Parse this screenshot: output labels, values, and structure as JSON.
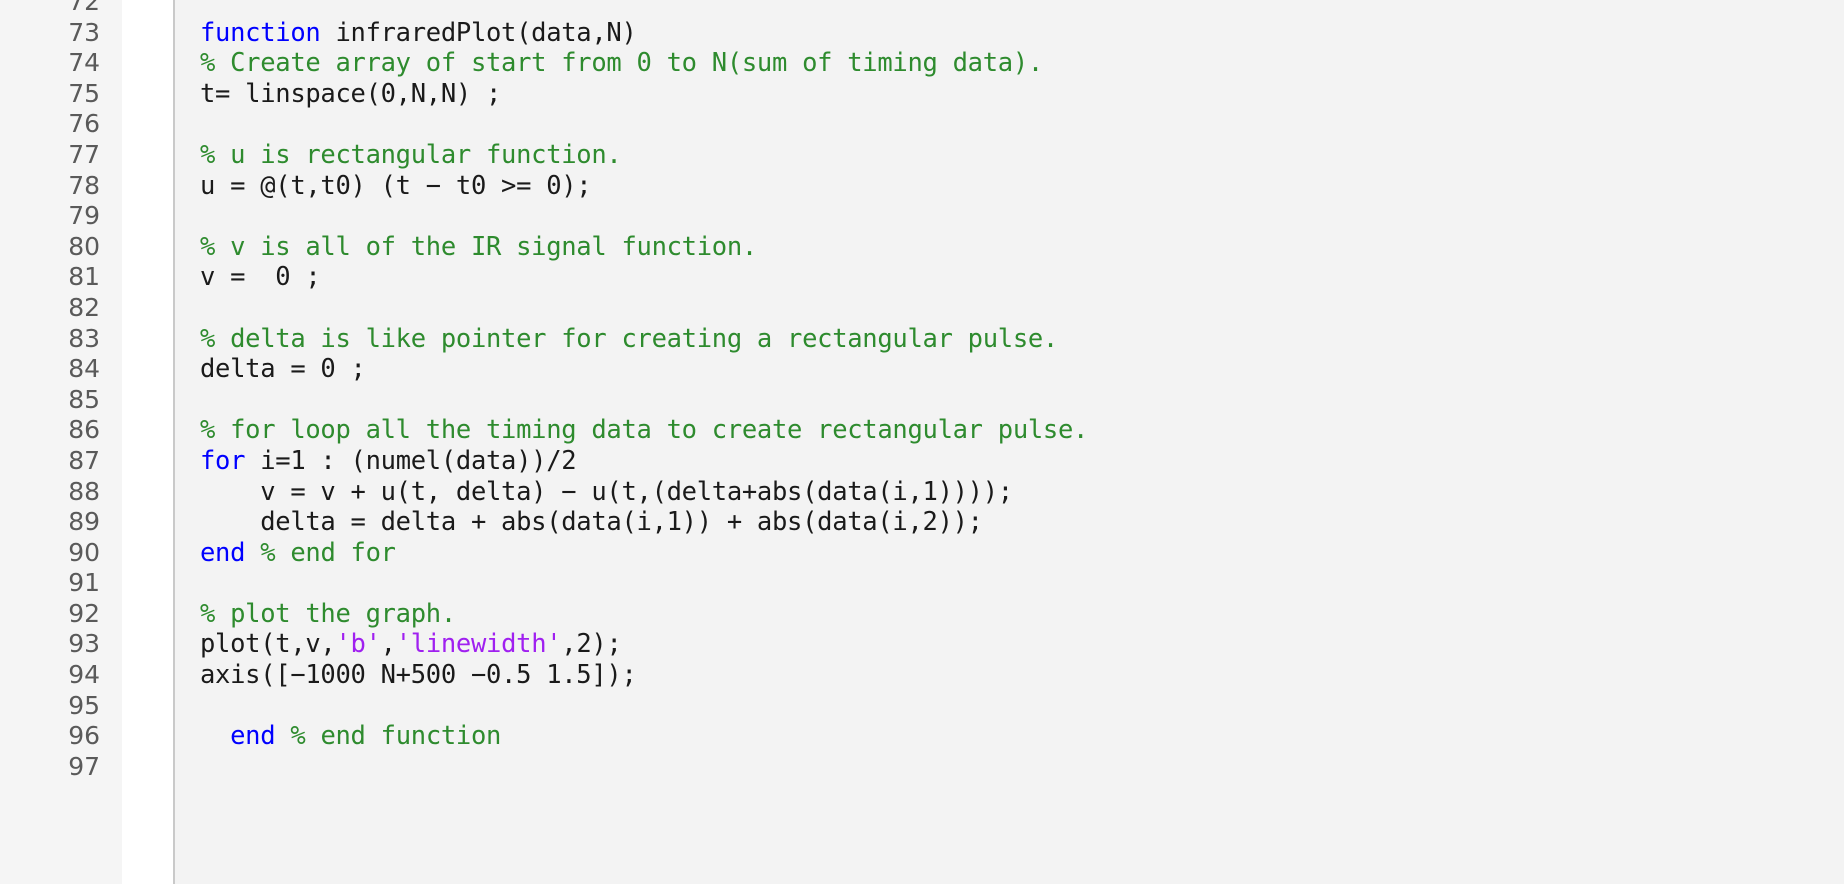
{
  "editor": {
    "language": "MATLAB",
    "colors": {
      "background": "#f3f3f3",
      "gutter_background": "#f5f5f5",
      "fold_column_background": "#ffffff",
      "separator": "#c9c9c9",
      "line_number": "#5a5a5a",
      "plain_text": "#1a1a1a",
      "keyword": "#0000ff",
      "comment": "#2e8b2e",
      "string": "#a020f0"
    },
    "first_line_number": 72,
    "last_line_number": 97,
    "lines": [
      {
        "number": "72",
        "tokens": [],
        "clipped": true
      },
      {
        "number": "73",
        "tokens": [
          {
            "kind": "keyword",
            "text": "function"
          },
          {
            "kind": "plain",
            "text": " infraredPlot(data,N)"
          }
        ]
      },
      {
        "number": "74",
        "tokens": [
          {
            "kind": "comment",
            "text": "% Create array of start from 0 to N(sum of timing data)."
          }
        ]
      },
      {
        "number": "75",
        "tokens": [
          {
            "kind": "plain",
            "text": "t= linspace(0,N,N) ;"
          }
        ]
      },
      {
        "number": "76",
        "tokens": []
      },
      {
        "number": "77",
        "tokens": [
          {
            "kind": "comment",
            "text": "% u is rectangular function."
          }
        ]
      },
      {
        "number": "78",
        "tokens": [
          {
            "kind": "plain",
            "text": "u = @(t,t0) (t − t0 >= 0);"
          }
        ]
      },
      {
        "number": "79",
        "tokens": []
      },
      {
        "number": "80",
        "tokens": [
          {
            "kind": "comment",
            "text": "% v is all of the IR signal function."
          }
        ]
      },
      {
        "number": "81",
        "tokens": [
          {
            "kind": "plain",
            "text": "v =  0 ;"
          }
        ]
      },
      {
        "number": "82",
        "tokens": []
      },
      {
        "number": "83",
        "tokens": [
          {
            "kind": "comment",
            "text": "% delta is like pointer for creating a rectangular pulse."
          }
        ]
      },
      {
        "number": "84",
        "tokens": [
          {
            "kind": "plain",
            "text": "delta = 0 ;"
          }
        ]
      },
      {
        "number": "85",
        "tokens": []
      },
      {
        "number": "86",
        "tokens": [
          {
            "kind": "comment",
            "text": "% for loop all the timing data to create rectangular pulse."
          }
        ]
      },
      {
        "number": "87",
        "tokens": [
          {
            "kind": "keyword",
            "text": "for"
          },
          {
            "kind": "plain",
            "text": " i=1 : (numel(data))/2"
          }
        ]
      },
      {
        "number": "88",
        "tokens": [
          {
            "kind": "plain",
            "text": "    v = v + u(t, delta) − u(t,(delta+abs(data(i,1))));"
          }
        ]
      },
      {
        "number": "89",
        "tokens": [
          {
            "kind": "plain",
            "text": "    delta = delta + abs(data(i,1)) + abs(data(i,2));"
          }
        ]
      },
      {
        "number": "90",
        "tokens": [
          {
            "kind": "keyword",
            "text": "end"
          },
          {
            "kind": "plain",
            "text": " "
          },
          {
            "kind": "comment",
            "text": "% end for"
          }
        ]
      },
      {
        "number": "91",
        "tokens": []
      },
      {
        "number": "92",
        "tokens": [
          {
            "kind": "comment",
            "text": "% plot the graph."
          }
        ]
      },
      {
        "number": "93",
        "tokens": [
          {
            "kind": "plain",
            "text": "plot(t,v,"
          },
          {
            "kind": "string",
            "text": "'b'"
          },
          {
            "kind": "plain",
            "text": ","
          },
          {
            "kind": "string",
            "text": "'linewidth'"
          },
          {
            "kind": "plain",
            "text": ",2);"
          }
        ]
      },
      {
        "number": "94",
        "tokens": [
          {
            "kind": "plain",
            "text": "axis([−1000 N+500 −0.5 1.5]);"
          }
        ]
      },
      {
        "number": "95",
        "tokens": []
      },
      {
        "number": "96",
        "tokens": [
          {
            "kind": "plain",
            "text": "  "
          },
          {
            "kind": "keyword",
            "text": "end"
          },
          {
            "kind": "plain",
            "text": " "
          },
          {
            "kind": "comment",
            "text": "% end function"
          }
        ]
      },
      {
        "number": "97",
        "tokens": [],
        "clipped": true
      }
    ]
  }
}
